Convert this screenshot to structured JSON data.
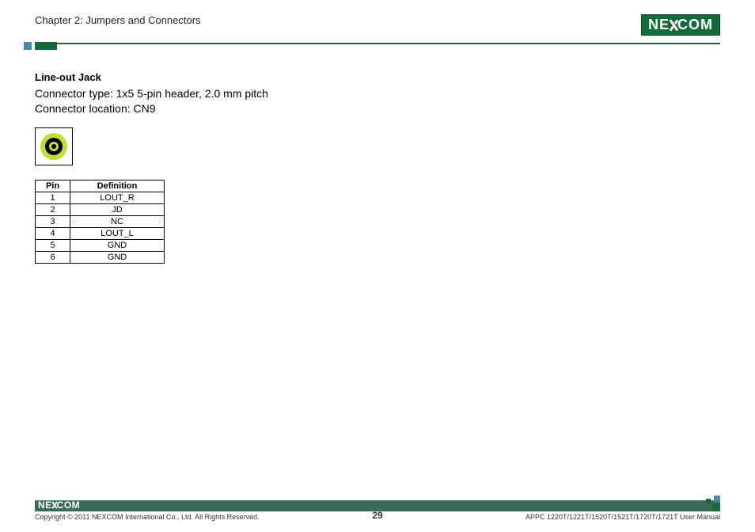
{
  "header": {
    "chapter": "Chapter 2: Jumpers and Connectors",
    "brand_left": "NE",
    "brand_right": "COM"
  },
  "section": {
    "title": "Line-out Jack",
    "type_line": "Connector type: 1x5 5-pin header, 2.0 mm pitch",
    "location_line": "Connector location: CN9"
  },
  "table": {
    "headers": {
      "pin": "Pin",
      "definition": "Definition"
    },
    "rows": [
      {
        "pin": "1",
        "definition": "LOUT_R"
      },
      {
        "pin": "2",
        "definition": "JD"
      },
      {
        "pin": "3",
        "definition": "NC"
      },
      {
        "pin": "4",
        "definition": "LOUT_L"
      },
      {
        "pin": "5",
        "definition": "GND"
      },
      {
        "pin": "6",
        "definition": "GND"
      }
    ]
  },
  "footer": {
    "brand_left": "NE",
    "brand_right": "COM",
    "copyright": "Copyright © 2011 NEXCOM International Co., Ltd. All Rights Reserved.",
    "manual": "APPC 1220T/1221T/1520T/1521T/1720T/1721T User Manual",
    "page": "29"
  },
  "colors": {
    "brand_green": "#136a3a",
    "accent_blue": "#4a8aa8",
    "jack_green": "#c4dc34"
  }
}
